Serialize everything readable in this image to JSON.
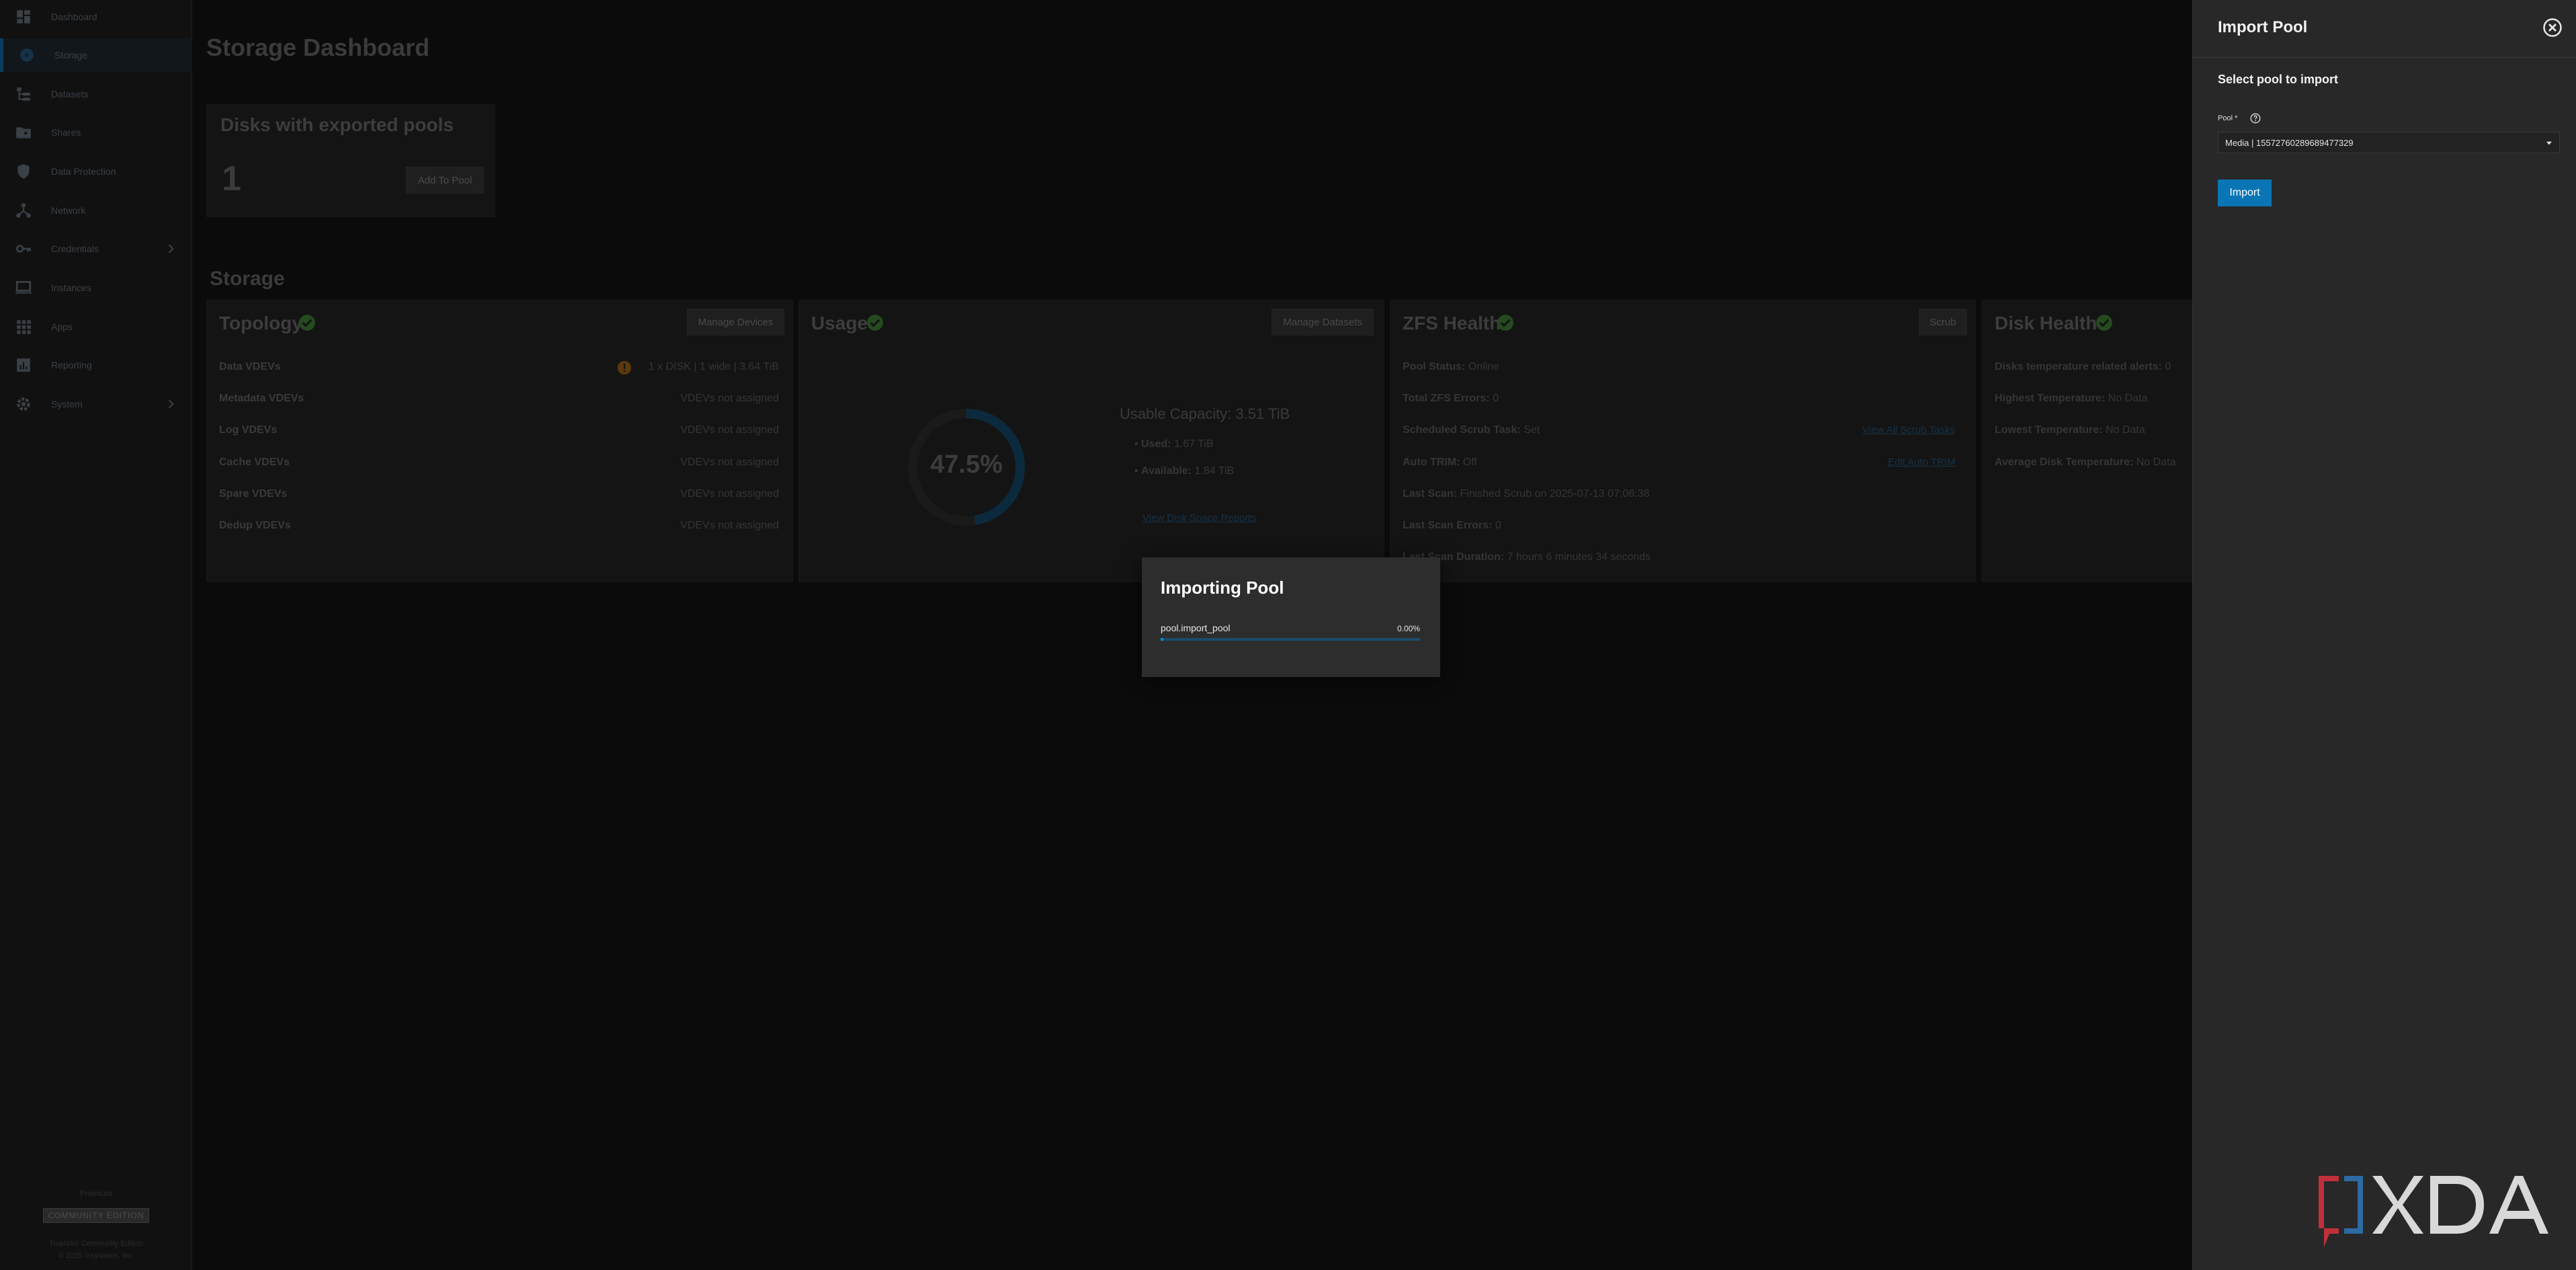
{
  "sidebar": {
    "items": [
      {
        "label": "Dashboard",
        "icon": "dashboard-icon"
      },
      {
        "label": "Storage",
        "icon": "storage-icon",
        "active": true
      },
      {
        "label": "Datasets",
        "icon": "datasets-icon"
      },
      {
        "label": "Shares",
        "icon": "shares-icon"
      },
      {
        "label": "Data Protection",
        "icon": "shield-icon"
      },
      {
        "label": "Network",
        "icon": "network-icon"
      },
      {
        "label": "Credentials",
        "icon": "key-icon",
        "expandable": true
      },
      {
        "label": "Instances",
        "icon": "monitor-icon"
      },
      {
        "label": "Apps",
        "icon": "apps-grid-icon"
      },
      {
        "label": "Reporting",
        "icon": "chart-icon"
      },
      {
        "label": "System",
        "icon": "gear-icon",
        "expandable": true
      }
    ],
    "footer_label": "Premium",
    "footer_badge": "COMMUNITY EDITION",
    "copyright_1": "TrueNAS Community Edition",
    "copyright_2": "© 2025 iXsystems, Inc."
  },
  "main": {
    "page_title": "Storage Dashboard",
    "exported_card": {
      "title": "Disks with exported pools",
      "count": "1",
      "button": "Add To Pool"
    },
    "storage_heading": "Storage",
    "topology": {
      "title": "Topology",
      "button": "Manage Devices",
      "rows": [
        {
          "label": "Data VDEVs",
          "value": "1 x DISK | 1 wide | 3.64 TiB",
          "warning": true
        },
        {
          "label": "Metadata VDEVs",
          "value": "VDEVs not assigned"
        },
        {
          "label": "Log VDEVs",
          "value": "VDEVs not assigned"
        },
        {
          "label": "Cache VDEVs",
          "value": "VDEVs not assigned"
        },
        {
          "label": "Spare VDEVs",
          "value": "VDEVs not assigned"
        },
        {
          "label": "Dedup VDEVs",
          "value": "VDEVs not assigned"
        }
      ]
    },
    "usage": {
      "title": "Usage",
      "button": "Manage Datasets",
      "percent": "47.5%",
      "percent_value": 47.5,
      "usable_label": "Usable Capacity:",
      "usable_value": "3.51 TiB",
      "used_label": "Used:",
      "used_value": "1.67 TiB",
      "available_label": "Available:",
      "available_value": "1.84 TiB",
      "link": "View Disk Space Reports"
    },
    "zfs": {
      "title": "ZFS Health",
      "button": "Scrub",
      "rows": [
        {
          "label": "Pool Status:",
          "value": "Online"
        },
        {
          "label": "Total ZFS Errors:",
          "value": "0"
        },
        {
          "label": "Scheduled Scrub Task:",
          "value": "Set",
          "link": "View All Scrub Tasks"
        },
        {
          "label": "Auto TRIM:",
          "value": "Off",
          "link": "Edit Auto TRIM"
        },
        {
          "label": "Last Scan:",
          "value": "Finished Scrub on 2025-07-13 07:06:38"
        },
        {
          "label": "Last Scan Errors:",
          "value": "0"
        },
        {
          "label": "Last Scan Duration:",
          "value": "7 hours 6 minutes 34 seconds"
        }
      ]
    },
    "disk_health": {
      "title": "Disk Health",
      "rows": [
        {
          "label": "Disks temperature related alerts:",
          "value": "0"
        },
        {
          "label": "Highest Temperature:",
          "value": "No Data"
        },
        {
          "label": "Lowest Temperature:",
          "value": "No Data"
        },
        {
          "label": "Average Disk Temperature:",
          "value": "No Data"
        }
      ]
    }
  },
  "dialog": {
    "title": "Importing Pool",
    "job": "pool.import_pool",
    "percent_label": "0.00%",
    "progress": 0.01
  },
  "panel": {
    "title": "Import Pool",
    "subtitle": "Select pool to import",
    "pool_label": "Pool *",
    "pool_value": "Media | 15572760289689477329",
    "import_button": "Import"
  },
  "colors": {
    "accent": "#0a75b4",
    "progress": "#0095d5",
    "ok": "#3c8a2e",
    "warn": "#a86a12"
  }
}
